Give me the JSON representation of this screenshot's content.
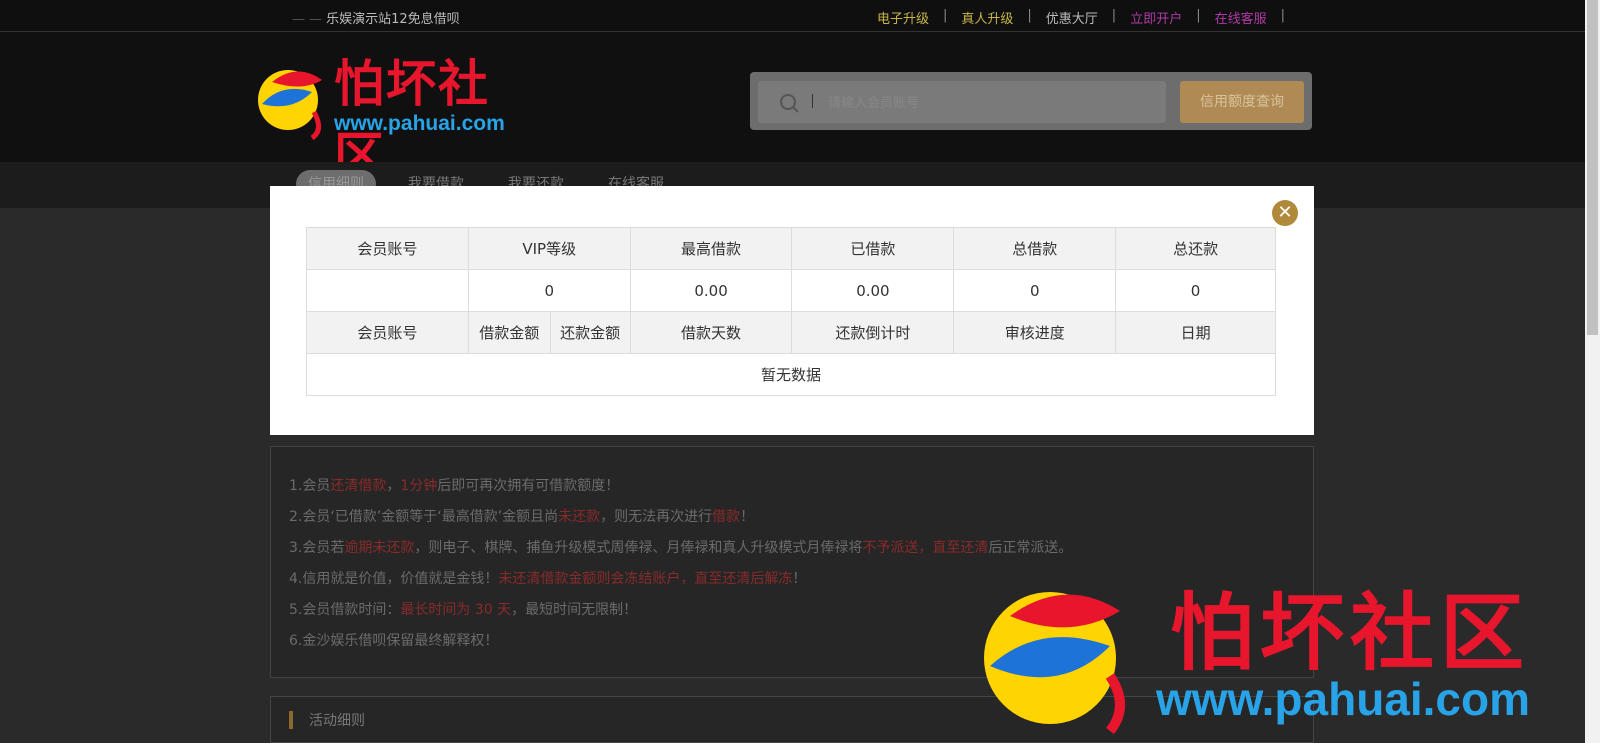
{
  "topbar": {
    "site_name": "乐娱演示站12免息借呗",
    "nav": [
      {
        "label": "电子升级",
        "color": "#c7b54a"
      },
      {
        "label": "真人升级",
        "color": "#c7b54a"
      },
      {
        "label": "优惠大厅",
        "color": "#bbbbbb"
      },
      {
        "label": "立即开户",
        "color": "#b03aa8"
      },
      {
        "label": "在线客服",
        "color": "#b03aa8"
      }
    ]
  },
  "logo": {
    "name": "怕坏社区",
    "url": "www.pahuai.com"
  },
  "search": {
    "placeholder": "请输入会员账号",
    "button": "信用额度查询"
  },
  "tabs": [
    "信用细则",
    "我要借款",
    "我要还款",
    "在线客服"
  ],
  "modal": {
    "close_icon": "close-icon",
    "summary_headers": [
      "会员账号",
      "VIP等级",
      "最高借款",
      "已借款",
      "总借款",
      "总还款"
    ],
    "summary_values": [
      "",
      "0",
      "0.00",
      "0.00",
      "0",
      "0"
    ],
    "detail_headers": [
      "会员账号",
      "借款金额",
      "还款金额",
      "借款天数",
      "还款倒计时",
      "审核进度",
      "日期"
    ],
    "empty_text": "暂无数据"
  },
  "rules": {
    "r1": {
      "a": "1.会员",
      "b": "还清借款",
      "c": "，",
      "d": "1分钟",
      "e": "后即可再次拥有可借款额度！"
    },
    "r2": {
      "a": "2.会员‘已借款’金额等于‘最高借款’金额且尚",
      "b": "未还款",
      "c": "，则无法再次进行",
      "d": "借款",
      "e": "！"
    },
    "r3": {
      "a": "3.会员若",
      "b": "逾期未还款",
      "c": "，则电子、棋牌、捕鱼升级模式周俸禄、月俸禄和真人升级模式月俸禄将",
      "d": "不予派送，直至还清",
      "e": "后正常派送。"
    },
    "r4": {
      "a": "4.信用就是价值，价值就是金钱！",
      "b": "未还清借款金额则会冻结账户，直至还清后解冻",
      "c": "！"
    },
    "r5": {
      "a": "5.会员借款时间：",
      "b": "最长时间为 30 天",
      "c": "，最短时间无限制！"
    },
    "r6": "6.金沙娱乐借呗保留最终解释权！"
  },
  "activity": {
    "title": "活动细则"
  },
  "watermark": {
    "name": "怕坏社区",
    "url": "www.pahuai.com"
  }
}
